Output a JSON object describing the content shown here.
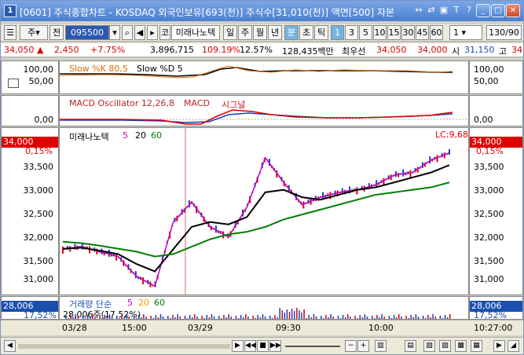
{
  "window": {
    "app_number": "1",
    "title": "[0601] 주식종합차트 - KOSDAQ 외국인보유[693(천)] 주식수[31,010(천)] 액면[500] 자본",
    "controls": [
      "↔",
      "⇄",
      "▣",
      "T",
      "?"
    ]
  },
  "toolbar": {
    "market": "주",
    "period_label": "전",
    "code": "095500",
    "name": "미래나노텍",
    "name_prefix": "코",
    "periods": [
      "일",
      "주",
      "월",
      "년",
      "분",
      "초",
      "틱"
    ],
    "active_period": "분",
    "intervals": [
      "1",
      "3",
      "5",
      "10",
      "15",
      "30",
      "45",
      "60"
    ],
    "active_interval": "1",
    "count_value": "1",
    "page": "130/90"
  },
  "quote": {
    "price": "34,050",
    "change": "2,450",
    "change_rate": "+7.75%",
    "volume": "3,896,715",
    "vol_ratio": "109.19%",
    "turnover": "12.57%",
    "amount": "128,435백만",
    "best_ask_label": "최우선",
    "best_ask": "34,050",
    "best_bid": "34,000",
    "open_label": "시",
    "open": "31,150",
    "high_label": "고",
    "high": "34"
  },
  "panels": {
    "stoch": {
      "legend_a": "Slow %K 80,5",
      "legend_b": "Slow %D 5",
      "ticks": [
        "100,00",
        "50,00"
      ]
    },
    "macd": {
      "legend_a": "MACD Oscillator 12,26,8",
      "legend_b": "MACD",
      "legend_c": "시그널",
      "ticks": [
        "0,00"
      ]
    },
    "price": {
      "legend_name": "미래나노텍",
      "ma": [
        "5",
        "20",
        "60"
      ],
      "current_box": "34,000",
      "current_pct": "0,15%",
      "hl_label": "LC:9,68",
      "ticks": [
        "33,500",
        "33,000",
        "32,500",
        "32,000",
        "31,500",
        "31,000"
      ]
    },
    "volume": {
      "legend": "거래량 단순",
      "ma": [
        "5",
        "20",
        "60"
      ],
      "info": "28,006주(17,52%)",
      "box": "28,006",
      "box_pct": "17,52%"
    }
  },
  "time_axis": {
    "labels": [
      "03/28",
      "15:00",
      "03/29",
      "09:30",
      "10:00",
      "10:27:00"
    ]
  },
  "chart_data": {
    "type": "line",
    "title": "",
    "xlabel": "",
    "ylabel": "",
    "ylim": [
      30800,
      34200
    ],
    "series": [
      {
        "name": "5",
        "values": [
          31750,
          31800,
          31700,
          31600,
          31200,
          31000,
          32300,
          32700,
          32200,
          32000,
          32600,
          33600,
          33100,
          32650,
          32800,
          32900,
          32950,
          33050,
          33250,
          33300,
          33550,
          33700
        ]
      },
      {
        "name": "20",
        "values": [
          31760,
          31780,
          31720,
          31650,
          31450,
          31300,
          31750,
          32200,
          32300,
          32250,
          32400,
          32900,
          32950,
          32800,
          32750,
          32850,
          32950,
          33000,
          33100,
          33200,
          33300,
          33450
        ]
      },
      {
        "name": "60",
        "values": [
          31900,
          31870,
          31820,
          31760,
          31700,
          31600,
          31650,
          31800,
          31950,
          32050,
          32100,
          32200,
          32350,
          32450,
          32550,
          32650,
          32750,
          32850,
          32900,
          32950,
          33000,
          33100
        ]
      }
    ],
    "x_labels": [
      "03/28",
      "15:00",
      "03/29",
      "09:30",
      "10:00"
    ]
  }
}
